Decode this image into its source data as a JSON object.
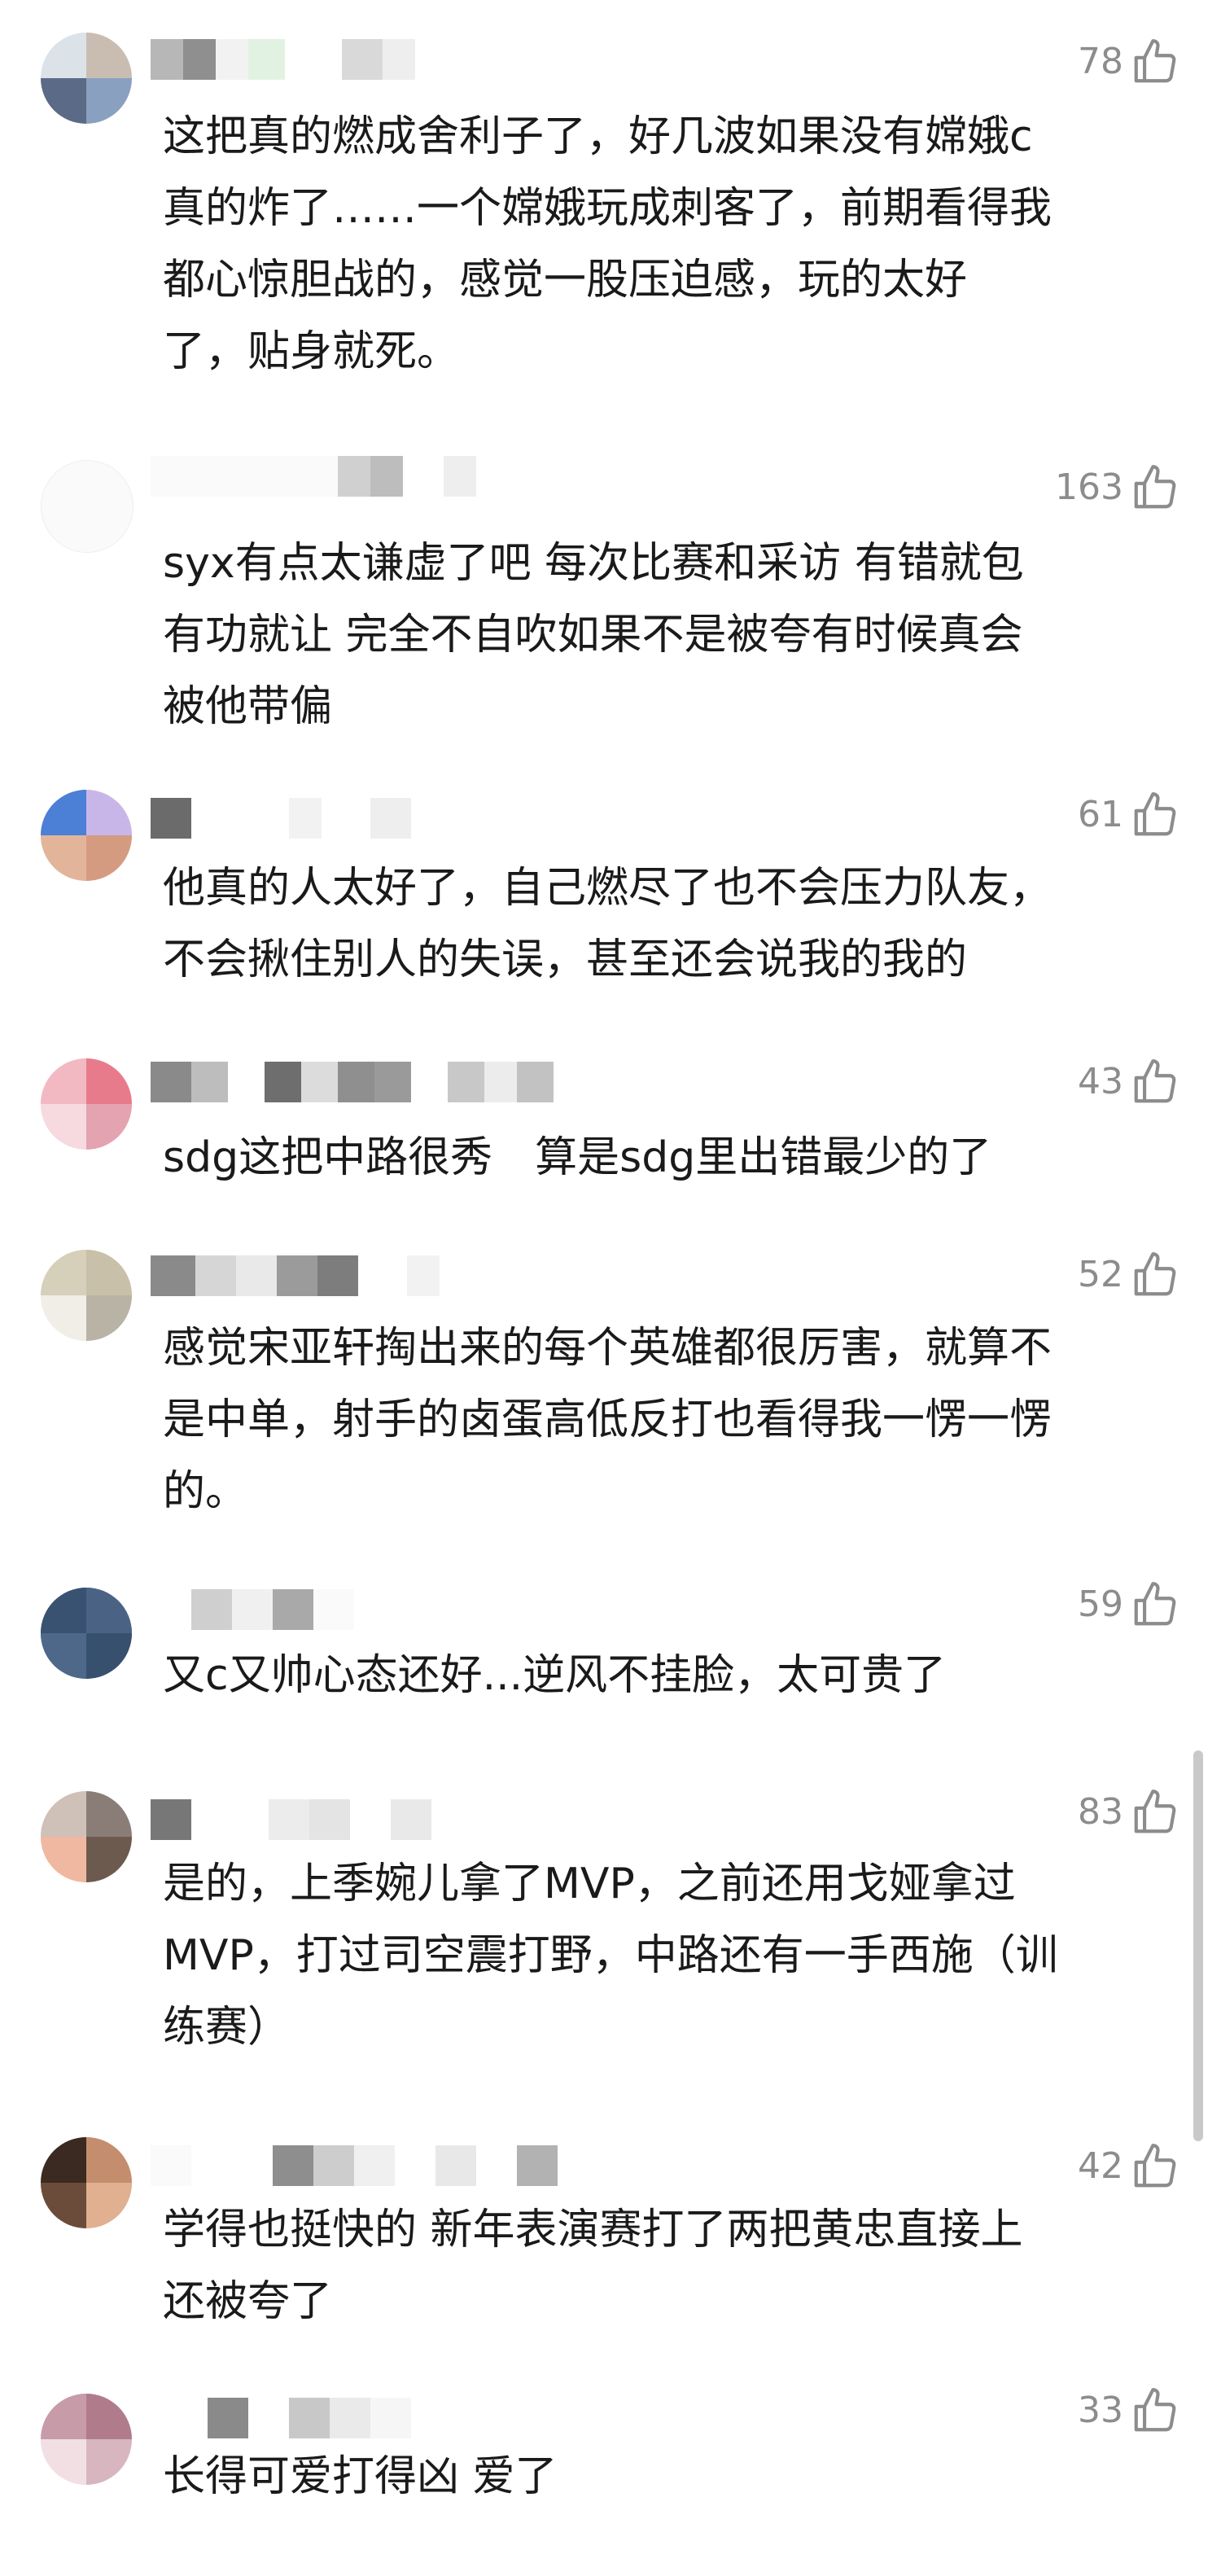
{
  "comments": [
    {
      "likes": "78",
      "text": "这把真的燃成舍利子了，好几波如果没有嫦娥c\n真的炸了……一个嫦娥玩成刺客了，前期看得我\n都心惊胆战的，感觉一股压迫感，玩的太好\n了，贴身就死。"
    },
    {
      "likes": "163",
      "text": "syx有点太谦虚了吧 每次比赛和采访 有错就包\n有功就让 完全不自吹如果不是被夸有时候真会\n被他带偏"
    },
    {
      "likes": "61",
      "text": "他真的人太好了，自己燃尽了也不会压力队友，\n不会揪住别人的失误，甚至还会说我的我的"
    },
    {
      "likes": "43",
      "text": "sdg这把中路很秀　算是sdg里出错最少的了"
    },
    {
      "likes": "52",
      "text": "感觉宋亚轩掏出来的每个英雄都很厉害，就算不\n是中单，射手的卤蛋高低反打也看得我一愣一愣\n的。"
    },
    {
      "likes": "59",
      "text": "又c又帅心态还好...逆风不挂脸，太可贵了"
    },
    {
      "likes": "83",
      "text": "是的，上季婉儿拿了MVP，之前还用戈娅拿过\nMVP，打过司空震打野，中路还有一手西施（训\n练赛）"
    },
    {
      "likes": "42",
      "text": "学得也挺快的 新年表演赛打了两把黄忠直接上\n还被夸了"
    },
    {
      "likes": "33",
      "text": "长得可爱打得凶 爱了"
    }
  ],
  "icons": {
    "like": "thumbs-up-icon"
  },
  "colors": {
    "text": "#1a1a1a",
    "meta": "#8c8c8c",
    "background": "#ffffff"
  }
}
